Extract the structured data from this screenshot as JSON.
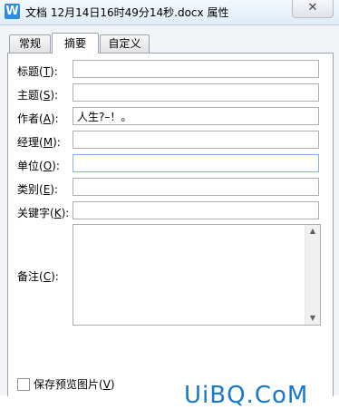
{
  "window": {
    "app_icon_letter": "W",
    "title": "文档 12月14日16时49分14秒.docx 属性",
    "close_symbol": "✕"
  },
  "tabs": [
    {
      "label": "常规",
      "active": false
    },
    {
      "label": "摘要",
      "active": true
    },
    {
      "label": "自定义",
      "active": false
    }
  ],
  "fields": [
    {
      "label": "标题",
      "key": "T",
      "value": ""
    },
    {
      "label": "主题",
      "key": "S",
      "value": ""
    },
    {
      "label": "作者",
      "key": "A",
      "value": "人生?–！。"
    },
    {
      "label": "经理",
      "key": "M",
      "value": ""
    },
    {
      "label": "单位",
      "key": "O",
      "value": ""
    },
    {
      "label": "类别",
      "key": "E",
      "value": ""
    },
    {
      "label": "关键字",
      "key": "K",
      "value": ""
    }
  ],
  "notes": {
    "label": "备注",
    "key": "C",
    "value": ""
  },
  "preview": {
    "label": "保存预览图片",
    "key": "V",
    "checked": false
  },
  "watermark": "UiBQ.CoM",
  "scroll": {
    "up": "▲",
    "down": "▼"
  }
}
